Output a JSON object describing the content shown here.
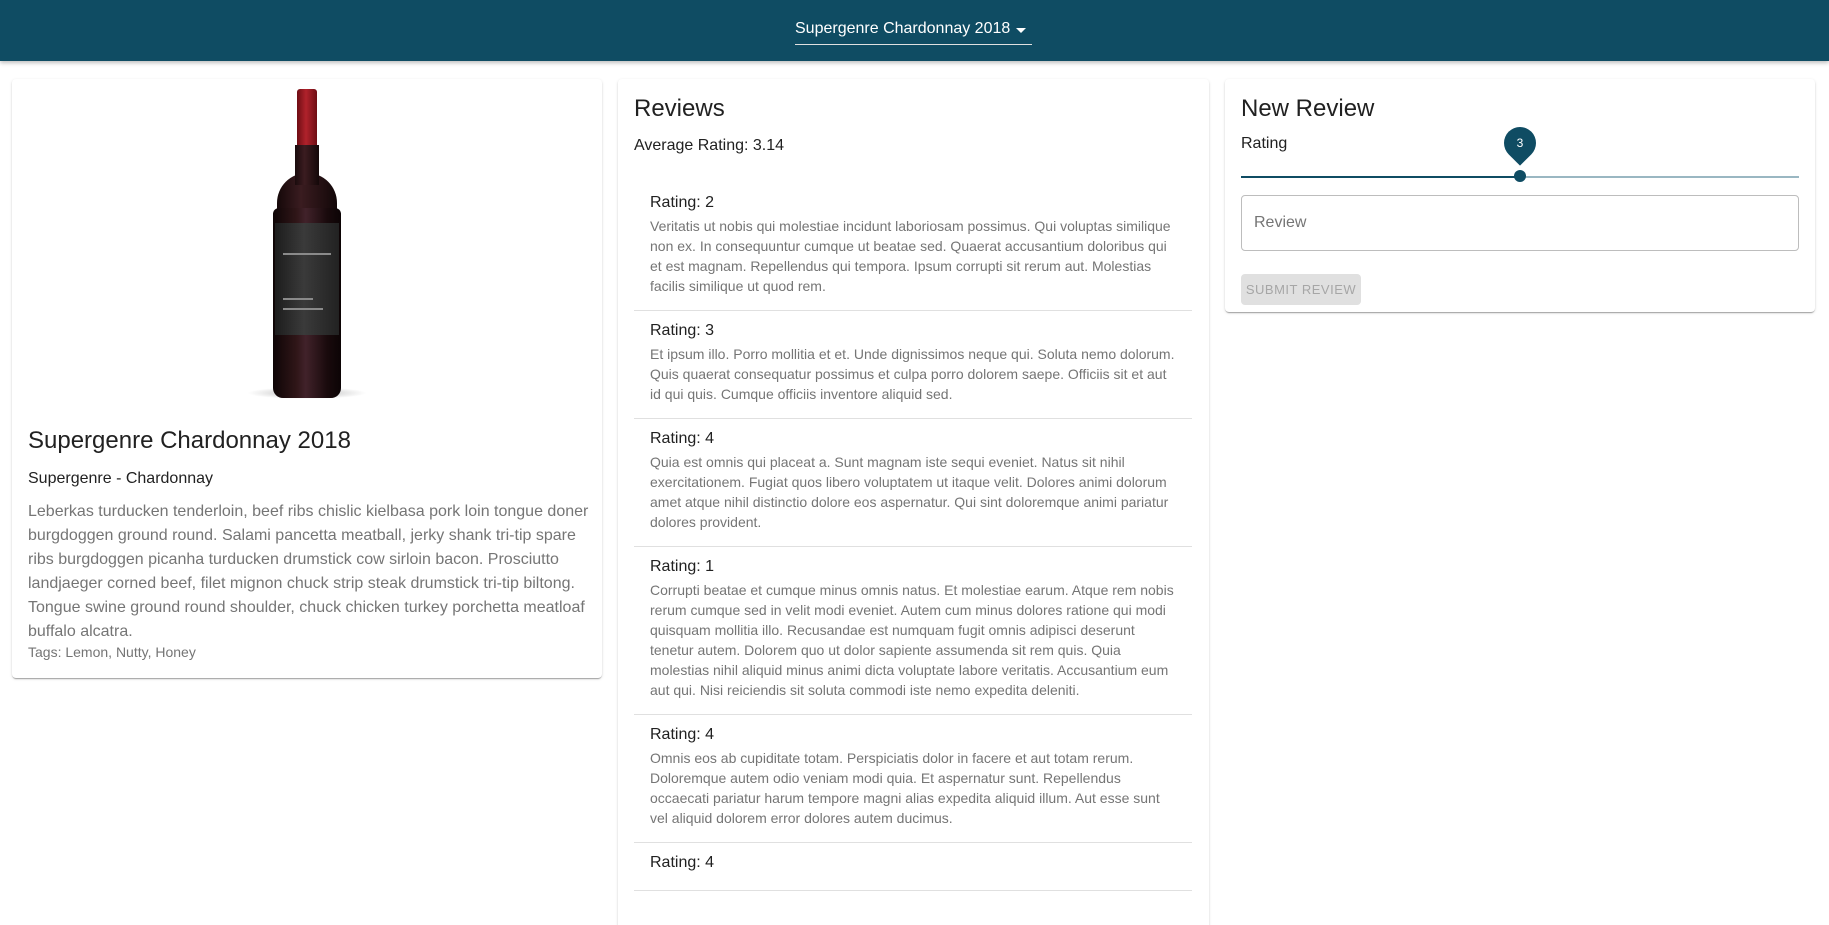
{
  "header": {
    "selected_wine": "Supergenre Chardonnay 2018",
    "background_color": "#0f4c63",
    "dropdown_icon": "caret-down-icon"
  },
  "wine": {
    "title": "Supergenre Chardonnay 2018",
    "subtitle": "Supergenre - Chardonnay",
    "description": "Leberkas turducken tenderloin, beef ribs chislic kielbasa pork loin tongue doner burgdoggen ground round. Salami pancetta meatball, jerky shank tri-tip spare ribs burgdoggen picanha turducken drumstick cow sirloin bacon. Prosciutto landjaeger corned beef, filet mignon chuck strip steak drumstick tri-tip biltong. Tongue swine ground round shoulder, chuck chicken turkey porchetta meatloaf buffalo alcatra.",
    "tags": "Tags: Lemon, Nutty, Honey"
  },
  "reviews": {
    "title": "Reviews",
    "average": "Average Rating: 3.14",
    "items": [
      {
        "rating": "Rating: 2",
        "text": "Veritatis ut nobis qui molestiae incidunt laboriosam possimus. Qui voluptas similique non ex. In consequuntur cumque ut beatae sed. Quaerat accusantium doloribus qui et est magnam. Repellendus qui tempora. Ipsum corrupti sit rerum aut. Molestias facilis similique ut quod rem."
      },
      {
        "rating": "Rating: 3",
        "text": "Et ipsum illo. Porro mollitia et et. Unde dignissimos neque qui. Soluta nemo dolorum. Quis quaerat consequatur possimus et culpa porro dolorem saepe. Officiis sit et aut id qui quis. Cumque officiis inventore aliquid sed."
      },
      {
        "rating": "Rating: 4",
        "text": "Quia est omnis qui placeat a. Sunt magnam iste sequi eveniet. Natus sit nihil exercitationem. Fugiat quos libero voluptatem ut itaque velit. Dolores animi dolorum amet atque nihil distinctio dolore eos aspernatur. Qui sint doloremque animi pariatur dolores provident."
      },
      {
        "rating": "Rating: 1",
        "text": "Corrupti beatae et cumque minus omnis natus. Et molestiae earum. Atque rem nobis rerum cumque sed in velit modi eveniet. Autem cum minus dolores ratione qui modi quisquam mollitia illo. Recusandae est numquam fugit omnis adipisci deserunt tenetur autem. Dolorem quo ut dolor sapiente assumenda sit rem quis. Quia molestias nihil aliquid minus animi dicta voluptate labore veritatis. Accusantium eum aut qui. Nisi reiciendis sit soluta commodi iste nemo expedita deleniti."
      },
      {
        "rating": "Rating: 4",
        "text": "Omnis eos ab cupiditate totam. Perspiciatis dolor in facere et aut totam rerum. Doloremque autem odio veniam modi quia. Et aspernatur sunt. Repellendus occaecati pariatur harum tempore magni alias expedita aliquid illum. Aut esse sunt vel aliquid dolorem error dolores autem ducimus."
      },
      {
        "rating": "Rating: 4",
        "text": ""
      }
    ]
  },
  "new_review": {
    "title": "New Review",
    "rating_label": "Rating",
    "rating_value": "3",
    "rating_fraction": 0.5,
    "review_placeholder": "Review",
    "review_value": "",
    "submit_label": "SUBMIT REVIEW"
  }
}
